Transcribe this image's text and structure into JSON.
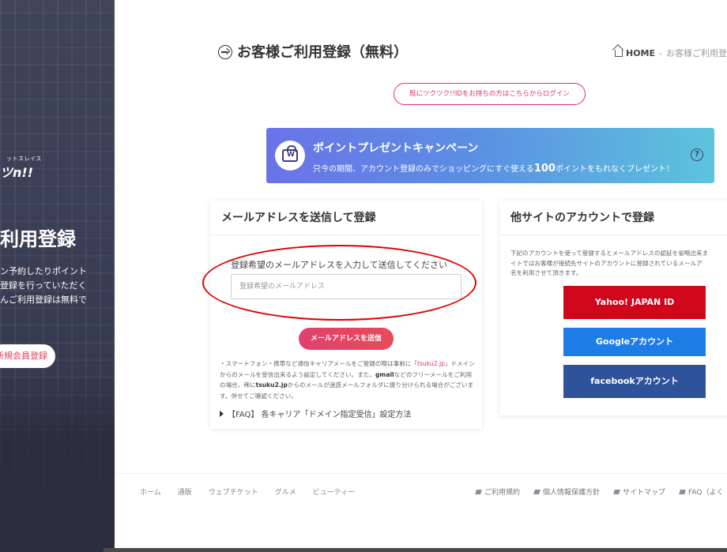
{
  "hero": {
    "logo_small": "ットスレイス",
    "logo": "ツn!!",
    "title": "利用登録",
    "desc_lines": [
      "ン予約したりポイント",
      "登録を行っていただく",
      "んご利用登録は無料で"
    ],
    "register_button": "新規会員登録"
  },
  "header": {
    "title": "お客様ご利用登録（無料）",
    "breadcrumb_home": "HOME",
    "breadcrumb_sep": "-",
    "breadcrumb_current": "お客様ご利用登録"
  },
  "login_pill": "既にツクツク!!IDをお持ちの方はこちらからログイン",
  "banner": {
    "title": "ポイントプレゼントキャンペーン",
    "text_before": "只今の期間、アカウント登録のみでショッピングにすぐ使える",
    "text_big": "100",
    "text_after": "ポイントをもれなくプレゼント！",
    "help": "?"
  },
  "email_card": {
    "heading": "メールアドレスを送信して登録",
    "label": "登録希望のメールアドレスを入力して送信してください",
    "input_value": "",
    "input_placeholder": "登録希望のメールアドレス",
    "send_button": "メールアドレスを送信",
    "note_1": "・スマートフォン・携帯など通信キャリアメールをご登録の際は事前に「",
    "note_hl": "tsuku2.jp",
    "note_2": "」ドメインからのメールを受信出来るよう設定してください。また、",
    "note_gmail": "gmail",
    "note_3": "などのフリーメールをご利用の場合、稀に",
    "note_domain": "tsuku2.jp",
    "note_4": "からのメールが迷惑メールフォルダに振り分けられる場合がございます。併せてご確認ください。",
    "faq_link": "【FAQ】 各キャリア「ドメイン指定受信」設定方法"
  },
  "social_card": {
    "heading": "他サイトのアカウントで登録",
    "desc": "下記のアカウントを使って登録するとメールアドレスの認証を省略出来ます。ではお客様が接続先サイトのアカウントに登録されているメールアドレスとお名前をご利用させて頂きます。",
    "desc_lines": [
      "下記のアカウントを使って登録するとメールアドレスの認証を省略出来ま",
      "イトではお客様が接続先サイトのアカウントに登録されているメールア",
      "名を利用させて頂きます。"
    ],
    "yahoo": "Yahoo! JAPAN ID",
    "google": "Googleアカウント",
    "facebook": "facebookアカウント"
  },
  "footer": {
    "nav": [
      "ホーム",
      "通販",
      "ウェブチケット",
      "グルメ",
      "ビューティー"
    ],
    "links": [
      "ご利用規約",
      "個人情報保護方針",
      "サイトマップ",
      "FAQ（よく"
    ]
  },
  "colors": {
    "accent_pink": "#e0306a",
    "yahoo_red": "#d0061a",
    "google_blue": "#1e7ce6",
    "facebook_blue": "#2f539b",
    "annotation_red": "#e00000"
  }
}
